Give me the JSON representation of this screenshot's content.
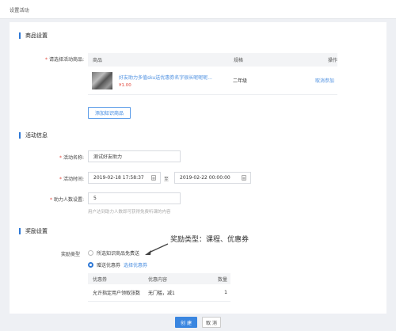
{
  "header": {
    "title": "设置活动"
  },
  "goods": {
    "section_title": "商品设置",
    "select_label": "请选择活动商品:",
    "columns": {
      "product": "商品",
      "spec": "规格",
      "action": "操作"
    },
    "rows": [
      {
        "name": "好友助力多值sku送优惠券名字很长呢呢呢...",
        "price": "¥1.00",
        "spec": "二年级",
        "action": "取消参加"
      }
    ],
    "add_button": "添加知识商品"
  },
  "activity": {
    "section_title": "活动信息",
    "name_label": "活动名称:",
    "name_value": "测试好友助力",
    "time_label": "活动时间:",
    "start_time": "2019-02-18 17:58:37",
    "to": "至",
    "end_time": "2019-02-22 00:00:00",
    "count_label": "助力人数设置:",
    "count_value": "5",
    "count_hint": "用户达到助力人数即可获得免费听课的内容"
  },
  "reward": {
    "section_title": "奖励设置",
    "type_label": "奖励类型",
    "option_free": "所选知识商品免费送",
    "option_coupon": "赠送优惠券",
    "select_coupon_link": "选择优惠券",
    "annotation": "奖励类型：课程、优惠券",
    "coupon_columns": {
      "coupon": "优惠券",
      "content": "优惠内容",
      "qty": "数量"
    },
    "coupon_rows": [
      {
        "coupon": "允许指定用户领取张数",
        "content": "无门槛，减1",
        "qty": "1"
      }
    ]
  },
  "footer": {
    "create": "创 建",
    "cancel": "取 消"
  },
  "colors": {
    "accent": "#2d78d6",
    "price": "#e2463a",
    "link": "#4a8ee0"
  }
}
